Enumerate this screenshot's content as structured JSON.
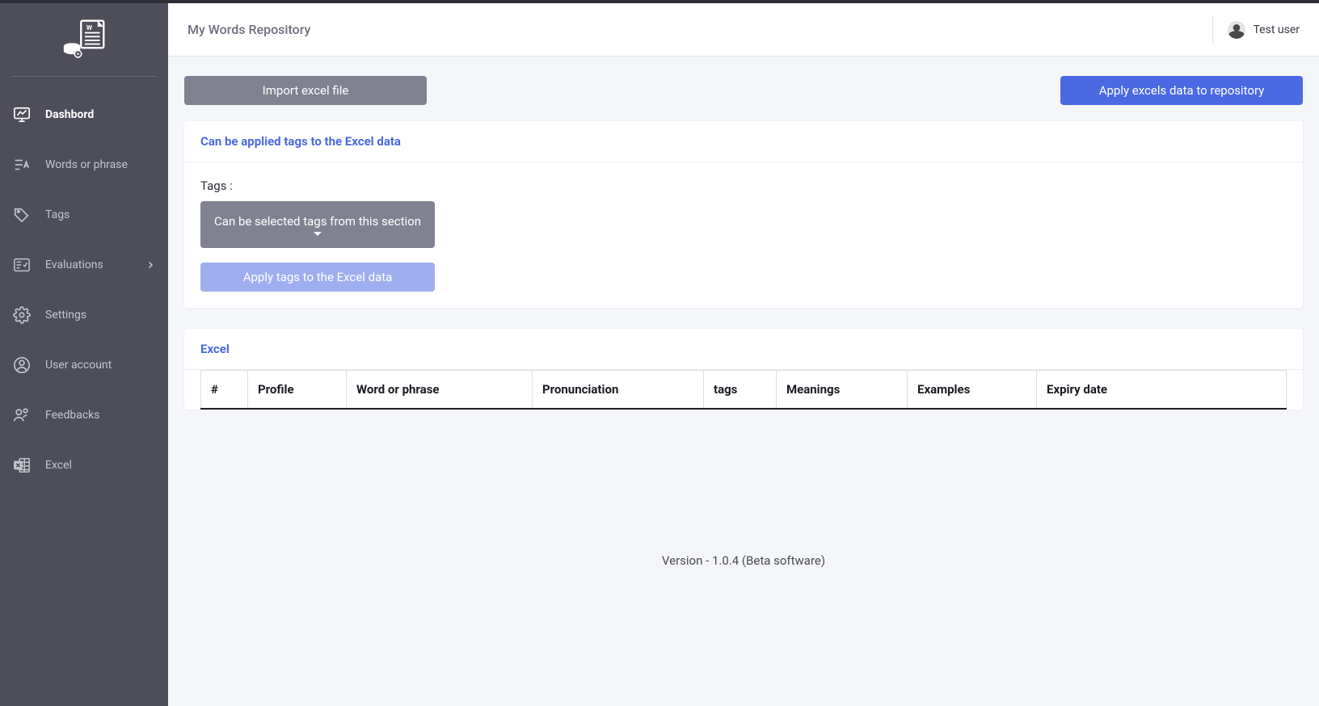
{
  "header": {
    "title": "My Words Repository",
    "user_name": "Test user"
  },
  "sidebar": {
    "items": [
      {
        "label": "Dashbord",
        "has_chevron": false
      },
      {
        "label": "Words or phrase",
        "has_chevron": false
      },
      {
        "label": "Tags",
        "has_chevron": false
      },
      {
        "label": "Evaluations",
        "has_chevron": true
      },
      {
        "label": "Settings",
        "has_chevron": false
      },
      {
        "label": "User account",
        "has_chevron": false
      },
      {
        "label": "Feedbacks",
        "has_chevron": false
      },
      {
        "label": "Excel",
        "has_chevron": false
      }
    ]
  },
  "actions": {
    "import_label": "Import excel file",
    "apply_repo_label": "Apply excels data to repository"
  },
  "tags_card": {
    "title": "Can be applied tags to the Excel data",
    "tags_label": "Tags :",
    "dropdown_placeholder": "Can be selected tags from this section",
    "apply_tags_label": "Apply tags to the Excel data"
  },
  "excel_card": {
    "title": "Excel",
    "columns": [
      "#",
      "Profile",
      "Word or phrase",
      "Pronunciation",
      "tags",
      "Meanings",
      "Examples",
      "Expiry date"
    ]
  },
  "footer": {
    "version_text": "Version - 1.0.4 (Beta software)"
  }
}
